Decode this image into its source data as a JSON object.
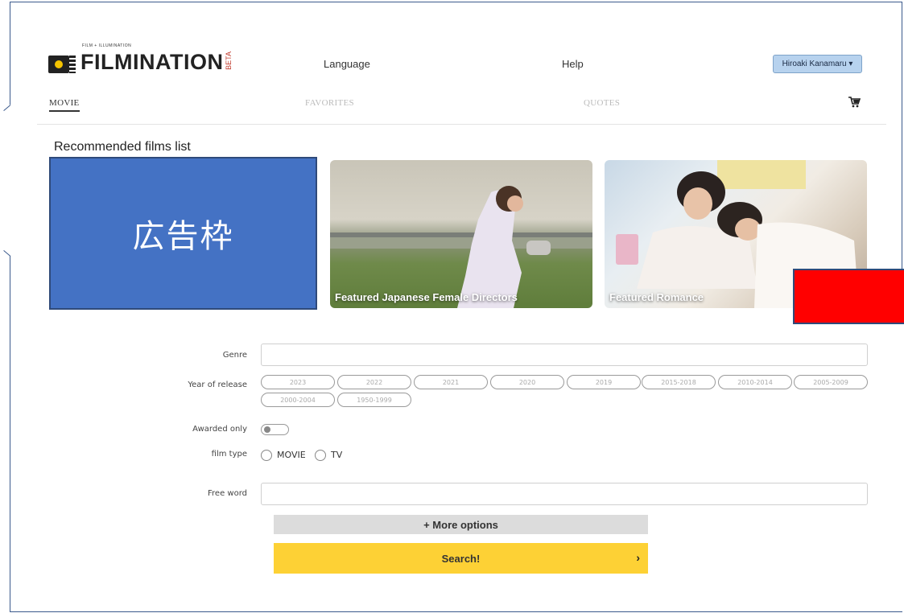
{
  "brand": {
    "tagline": "FILM + ILLUMINATION",
    "name": "FILMINATION",
    "badge": "BETA"
  },
  "header": {
    "language_label": "Language",
    "help_label": "Help",
    "user_label": "Hiroaki Kanamaru ▾"
  },
  "tabs": [
    {
      "label": "MOVIE",
      "active": true
    },
    {
      "label": "FAVORITES",
      "active": false
    },
    {
      "label": "QUOTES",
      "active": false
    }
  ],
  "cart_icon": "cart-icon",
  "recommended": {
    "title": "Recommended films list",
    "ad_label": "広告枠",
    "cards": [
      {
        "label": "Featured Japanese Female Directors"
      },
      {
        "label": "Featured Romance"
      }
    ]
  },
  "form": {
    "genre_label": "Genre",
    "genre_value": "",
    "year_label": "Year of release",
    "years": [
      "2023",
      "2022",
      "2021",
      "2020",
      "2019",
      "2015-2018",
      "2010-2014",
      "2005-2009",
      "2000-2004",
      "1950-1999"
    ],
    "awarded_label": "Awarded only",
    "awarded_on": false,
    "film_type_label": "film type",
    "film_types": [
      "MOVIE",
      "TV"
    ],
    "free_word_label": "Free word",
    "free_word_value": "",
    "more_options_label": "+ More options",
    "search_label": "Search!"
  },
  "colors": {
    "ad_box": "#4472c4",
    "red_box": "#ff0000",
    "search_button": "#fdd135",
    "user_button": "#b7d2ee"
  }
}
